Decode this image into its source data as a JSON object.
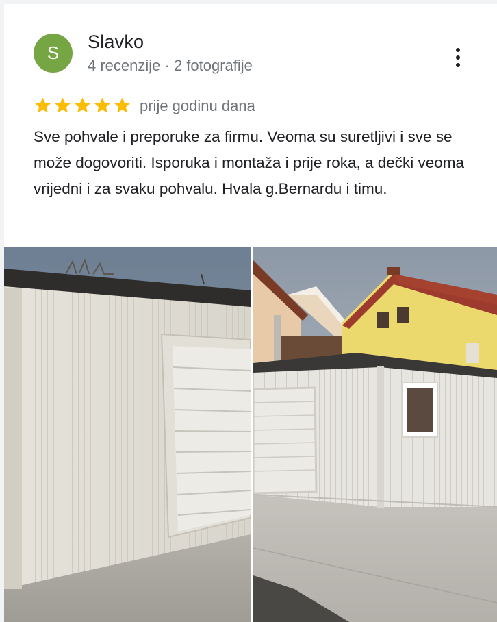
{
  "reviewer": {
    "initial": "S",
    "name": "Slavko",
    "meta": "4 recenzije · 2 fotografije",
    "avatar_color": "#76a544"
  },
  "menu": {
    "icon": "more-vert-icon"
  },
  "rating": {
    "stars": 5,
    "max": 5,
    "star_color": "#fbbc04",
    "date": "prije godinu dana"
  },
  "review": {
    "text": "Sve pohvale i preporuke za firmu. Veoma su suretljivi i sve se može dogovoriti. Isporuka i montaža i prije roka, a dečki veoma vrijedni i za svaku pohvalu. Hvala g.Bernardu i timu."
  },
  "photos": [
    {
      "description": "garage-door-closeup"
    },
    {
      "description": "prefab-garage-with-window"
    }
  ]
}
